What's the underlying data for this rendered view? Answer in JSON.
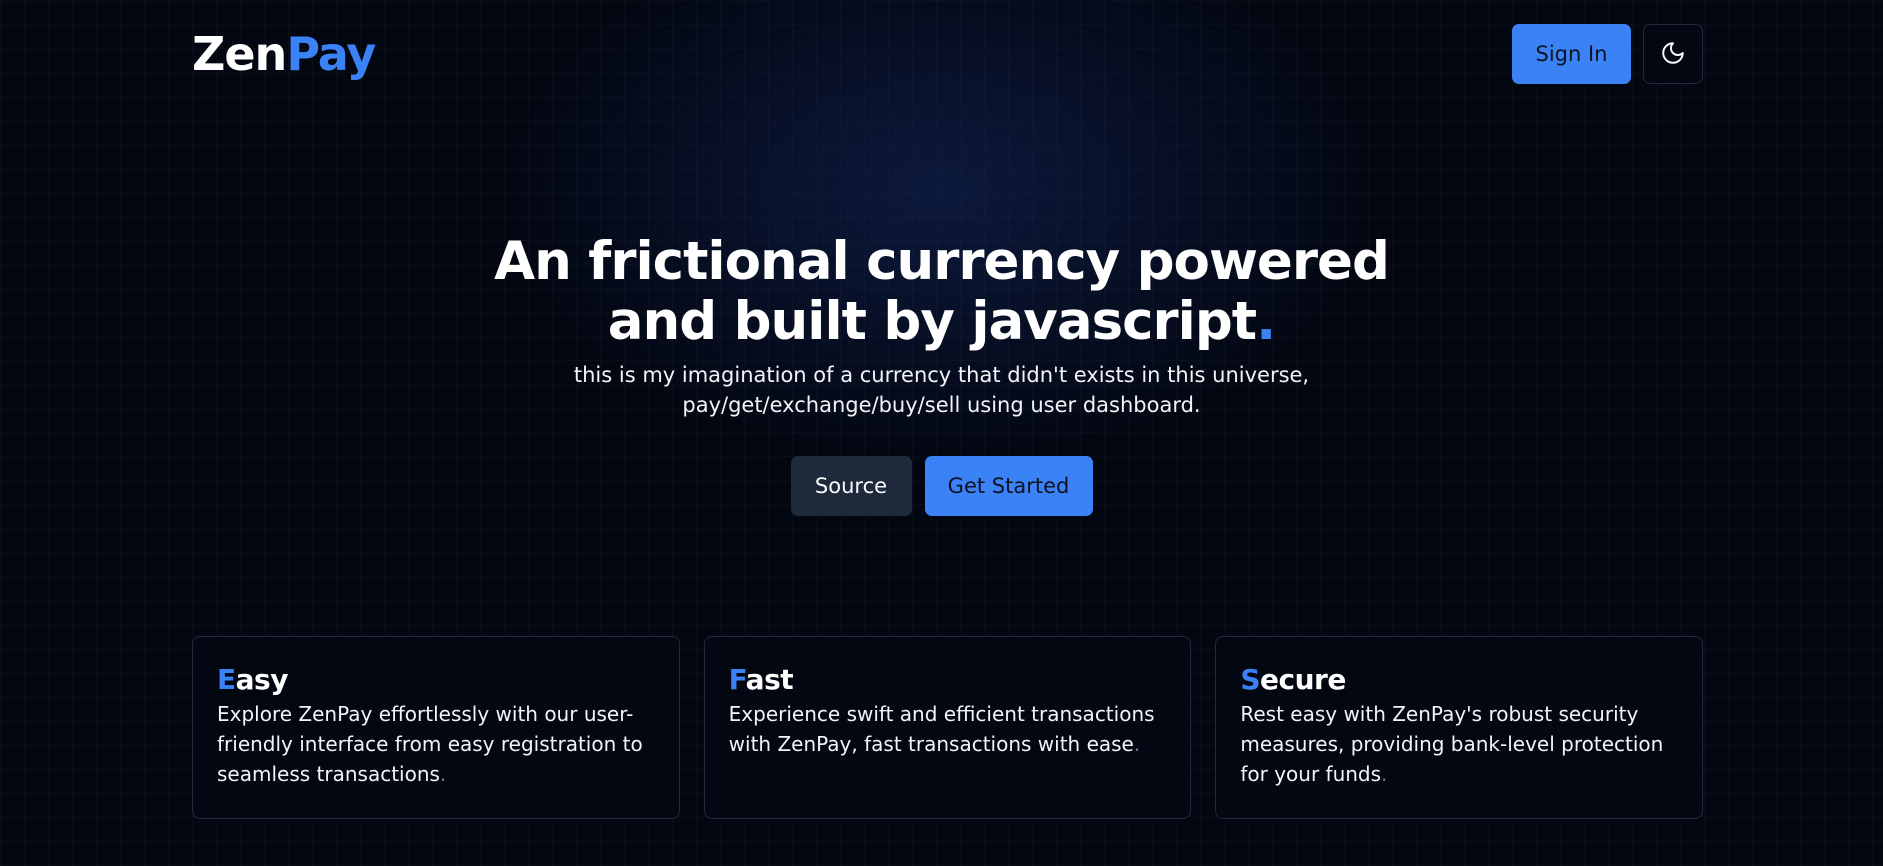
{
  "brand": {
    "part1": "Zen",
    "part2": "Pay"
  },
  "header": {
    "signin_label": "Sign In",
    "theme_icon": "moon-icon"
  },
  "hero": {
    "headline_line1": "An frictional currency powered",
    "headline_line2": "and built by javascript",
    "headline_dot": ".",
    "sub_line1": "this is my imagination of a currency that didn't exists in this universe,",
    "sub_line2": "pay/get/exchange/buy/sell using user dashboard.",
    "source_label": "Source",
    "get_started_label": "Get Started"
  },
  "features": [
    {
      "title_first": "E",
      "title_rest": "asy",
      "text": "Explore ZenPay effortlessly with our user-friendly interface from easy registration to seamless transactions",
      "end": "."
    },
    {
      "title_first": "F",
      "title_rest": "ast",
      "text": "Experience swift and efficient transactions with ZenPay, fast transactions with ease",
      "end": "."
    },
    {
      "title_first": "S",
      "title_rest": "ecure",
      "text": "Rest easy with ZenPay's robust security measures, providing bank-level protection for your funds",
      "end": "."
    }
  ],
  "colors": {
    "accent": "#3b82f6",
    "background": "#030712",
    "card_border": "#1f2937",
    "secondary_button": "#1e293b"
  }
}
